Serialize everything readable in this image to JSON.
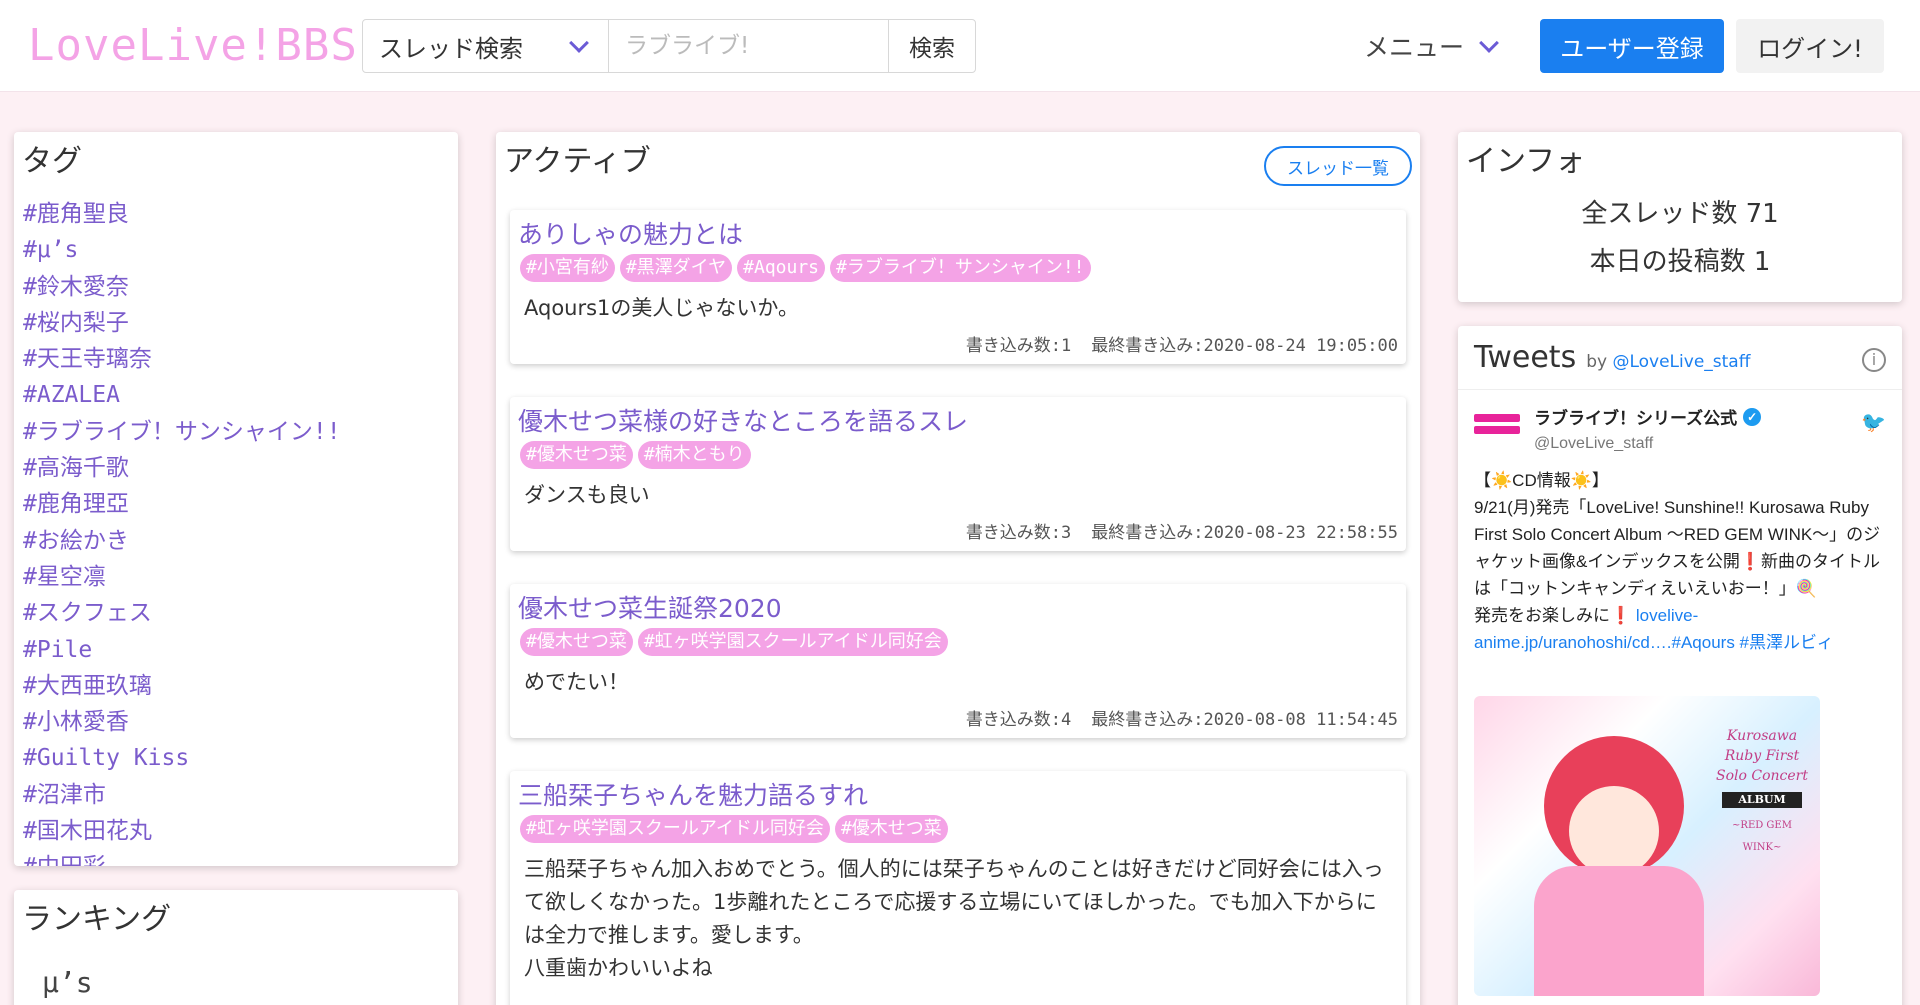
{
  "header": {
    "logo": "LoveLive!BBS!",
    "search_select": "スレッド検索",
    "search_placeholder": "ラブライブ!",
    "search_button": "検索",
    "menu": "メニュー",
    "register": "ユーザー登録",
    "login": "ログイン!"
  },
  "tags_panel": {
    "title": "タグ",
    "items": [
      "#鹿角聖良",
      "#μ’s",
      "#鈴木愛奈",
      "#桜内梨子",
      "#天王寺璃奈",
      "#AZALEA",
      "#ラブライブ！サンシャイン!!",
      "#高海千歌",
      "#鹿角理亞",
      "#お絵かき",
      "#星空凛",
      "#スクフェス",
      "#Pile",
      "#大西亜玖璃",
      "#小林愛香",
      "#Guilty Kiss",
      "#沼津市",
      "#国木田花丸",
      "#中田彩"
    ]
  },
  "ranking_panel": {
    "title": "ランキング",
    "items": [
      "μ’s"
    ]
  },
  "active_panel": {
    "title": "アクティブ",
    "list_button": "スレッド一覧",
    "threads": [
      {
        "title": "ありしゃの魅力とは",
        "tags": [
          "#小宮有紗",
          "#黒澤ダイヤ",
          "#Aqours",
          "#ラブライブ！サンシャイン!!"
        ],
        "body": "Aqours1の美人じゃないか。",
        "count": "書き込み数:1",
        "last": "最終書き込み:2020-08-24 19:05:00"
      },
      {
        "title": "優木せつ菜様の好きなところを語るスレ",
        "tags": [
          "#優木せつ菜",
          "#楠木ともり"
        ],
        "body": "ダンスも良い",
        "count": "書き込み数:3",
        "last": "最終書き込み:2020-08-23 22:58:55"
      },
      {
        "title": "優木せつ菜生誕祭2020",
        "tags": [
          "#優木せつ菜",
          "#虹ヶ咲学園スクールアイドル同好会"
        ],
        "body": "めでたい！",
        "count": "書き込み数:4",
        "last": "最終書き込み:2020-08-08 11:54:45"
      },
      {
        "title": "三船栞子ちゃんを魅力語るすれ",
        "tags": [
          "#虹ヶ咲学園スクールアイドル同好会",
          "#優木せつ菜"
        ],
        "body": "三船栞子ちゃん加入おめでとう。個人的には栞子ちゃんのことは好きだけど同好会には入って欲しくなかった。1歩離れたところで応援する立場にいてほしかった。でも加入下からには全力で推します。愛します。\n八重歯かわいいよね",
        "count": "",
        "last": ""
      }
    ]
  },
  "info_panel": {
    "title": "インフォ",
    "threads_total": "全スレッド数 71",
    "posts_today": "本日の投稿数 1"
  },
  "tweets": {
    "title": "Tweets",
    "by_prefix": "by",
    "by_handle": "@LoveLive_staff",
    "user_name": "ラブライブ！シリーズ公式",
    "user_handle": "@LoveLive_staff",
    "text_1": "【☀️CD情報☀️】",
    "text_2": "9/21(月)発売「LoveLive! Sunshine!! Kurosawa Ruby First Solo Concert Album 〜RED GEM WINK〜」のジャケット画像&インデックスを公開❗新曲のタイトルは「コットンキャンディえいえいおー！」🍭",
    "text_3": "発売をお楽しみに❗",
    "link": "lovelive-anime.jp/uranohoshi/cd….",
    "hashtags": "#Aqours #黒澤ルビィ",
    "image_title": "Kurosawa Ruby First Solo Concert",
    "image_album": "ALBUM",
    "image_sub": "~RED GEM WINK~"
  },
  "colors": {
    "accent": "#7b5ccc",
    "pink": "#f4a3e6",
    "blue": "#1a7ff0",
    "bg": "#fdf0f4"
  }
}
